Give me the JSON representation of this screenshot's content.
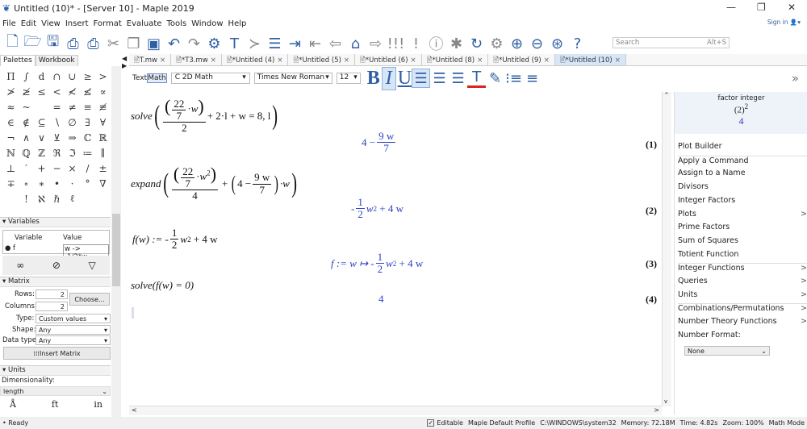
{
  "title": "Untitled (10)* - [Server 10] - Maple 2019",
  "menu": [
    "File",
    "Edit",
    "View",
    "Insert",
    "Format",
    "Evaluate",
    "Tools",
    "Window",
    "Help"
  ],
  "signin": "Sign in",
  "toolbar_icons": [
    "new-document-icon",
    "open-folder-icon",
    "save-icon",
    "print-icon",
    "print-preview-icon",
    "cut-icon",
    "copy-icon",
    "paste-icon",
    "undo-icon",
    "redo-icon",
    "insert-math-icon",
    "insert-text-icon",
    "execution-group-icon",
    "insert-section-icon",
    "indent-icon",
    "outdent-icon",
    "back-icon",
    "home-icon",
    "forward-icon",
    "execute-all-icon",
    "execute-icon",
    "stop-icon",
    "debug-icon",
    "restart-icon",
    "settings-icon",
    "zoom-in-icon",
    "zoom-out-icon",
    "zoom-fit-icon",
    "help-icon"
  ],
  "search": {
    "placeholder": "Search",
    "shortcut": "Alt+S"
  },
  "left_tabs": [
    "Palettes",
    "Workbook"
  ],
  "doc_tabs": [
    {
      "label": "T.mw"
    },
    {
      "label": "*T3.mw"
    },
    {
      "label": "*Untitled (4)"
    },
    {
      "label": "*Untitled (5)"
    },
    {
      "label": "*Untitled (6)"
    },
    {
      "label": "*Untitled (8)"
    },
    {
      "label": "*Untitled (9)"
    },
    {
      "label": "*Untitled (10)",
      "active": true
    }
  ],
  "format": {
    "text": "Text",
    "math": "Math",
    "mode": "2D Math",
    "font": "Times New Roman",
    "size": "12",
    "bold": "B",
    "italic": "I",
    "underline": "U"
  },
  "palette_symbols": [
    "Π",
    "∫",
    "d",
    "∩",
    "∪",
    "≥",
    ">",
    "≯",
    "≱",
    "≤",
    "<",
    "≮",
    "≰",
    "∝",
    "≈",
    "~",
    "",
    "=",
    "≠",
    "≡",
    "≢",
    "∈",
    "∉",
    "⊆",
    "∖",
    "∅",
    "∃",
    "∀",
    "¬",
    "∧",
    "∨",
    "⊻",
    "⇒",
    "ℂ",
    "ℝ",
    "ℕ",
    "ℚ",
    "ℤ",
    "ℜ",
    "ℑ",
    "≔",
    "∥",
    "⊥",
    "′",
    "+",
    "−",
    "×",
    "/",
    "±",
    "∓",
    "∘",
    "∗",
    "•",
    "·",
    "°",
    "∇",
    "",
    "!",
    "ℵ",
    "ℏ",
    "ℓ",
    "",
    ""
  ],
  "variables": {
    "header": "Variables",
    "col_variable": "Variable",
    "col_value": "Value",
    "rows": [
      {
        "name": "f",
        "value": "w -> -1/2*w..."
      }
    ]
  },
  "matrix": {
    "header": "Matrix",
    "rows_label": "Rows:",
    "rows": "2",
    "cols_label": "Columns:",
    "cols": "2",
    "choose": "Choose...",
    "type_label": "Type:",
    "type": "Custom values",
    "shape_label": "Shape:",
    "shape": "Any",
    "dtype_label": "Data type:",
    "dtype": "Any",
    "insert": "Insert Matrix"
  },
  "units": {
    "header": "Units",
    "dim_label": "Dimensionality:",
    "dim": "length",
    "symbols": [
      "Å",
      "ft",
      "in"
    ]
  },
  "document": {
    "in1": {
      "fn": "solve",
      "num": "22",
      "den": "7",
      "var": "w",
      "outer_den": "2",
      "rest": "+ 2·l + w = 8, l"
    },
    "out1": {
      "a": "4 −",
      "num": "9 w",
      "den": "7",
      "label": "(1)"
    },
    "in2": {
      "fn": "expand",
      "num": "22",
      "den": "7",
      "var": "w",
      "exp": "2",
      "outer_den": "4",
      "mid": "+",
      "a": "4 −",
      "num2": "9 w",
      "den2": "7",
      "tail": "·w"
    },
    "out2": {
      "sign": "-",
      "num": "1",
      "den": "2",
      "var": "w",
      "exp": "2",
      "rest": "+ 4 w",
      "label": "(2)"
    },
    "in3": {
      "lhs": "f(w) :=",
      "sign": "-",
      "num": "1",
      "den": "2",
      "var": "w",
      "exp": "2",
      "rest": "+ 4 w"
    },
    "out3": {
      "lhs": "f := w ↦",
      "sign": "-",
      "num": "1",
      "den": "2",
      "var": "w",
      "exp": "2",
      "rest": "+ 4 w",
      "label": "(3)"
    },
    "in4": {
      "text": "solve(f(w) = 0)"
    },
    "out4": {
      "value": "4",
      "label": "(4)"
    }
  },
  "context_panel": {
    "preview_title": "factor integer",
    "preview_expr": "(2)",
    "preview_exp": "2",
    "preview_result": "4",
    "items": [
      {
        "label": "Plot Builder"
      },
      {
        "label": "Apply a Command",
        "sep": true
      },
      {
        "label": "Assign to a Name"
      },
      {
        "label": "Divisors"
      },
      {
        "label": "Integer Factors"
      },
      {
        "label": "Plots",
        "sub": true
      },
      {
        "label": "Prime Factors"
      },
      {
        "label": "Sum of Squares"
      },
      {
        "label": "Totient Function"
      },
      {
        "label": "Integer Functions",
        "sub": true,
        "sep": true
      },
      {
        "label": "Queries",
        "sub": true
      },
      {
        "label": "Units",
        "sub": true
      },
      {
        "label": "Combinations/Permutations",
        "sub": true,
        "sep": true
      },
      {
        "label": "Number Theory Functions",
        "sub": true
      },
      {
        "label": "Number Format:"
      }
    ],
    "number_format": "None"
  },
  "status": {
    "ready": "Ready",
    "editable": "Editable",
    "profile": "Maple Default Profile",
    "dir": "C:\\WINDOWS\\system32",
    "memory": "Memory: 72.18M",
    "time": "Time: 4.82s",
    "zoom": "Zoom: 100%",
    "mode": "Math Mode"
  },
  "colors": {
    "accent": "#2f5fa3",
    "output": "#2b3fc4"
  }
}
